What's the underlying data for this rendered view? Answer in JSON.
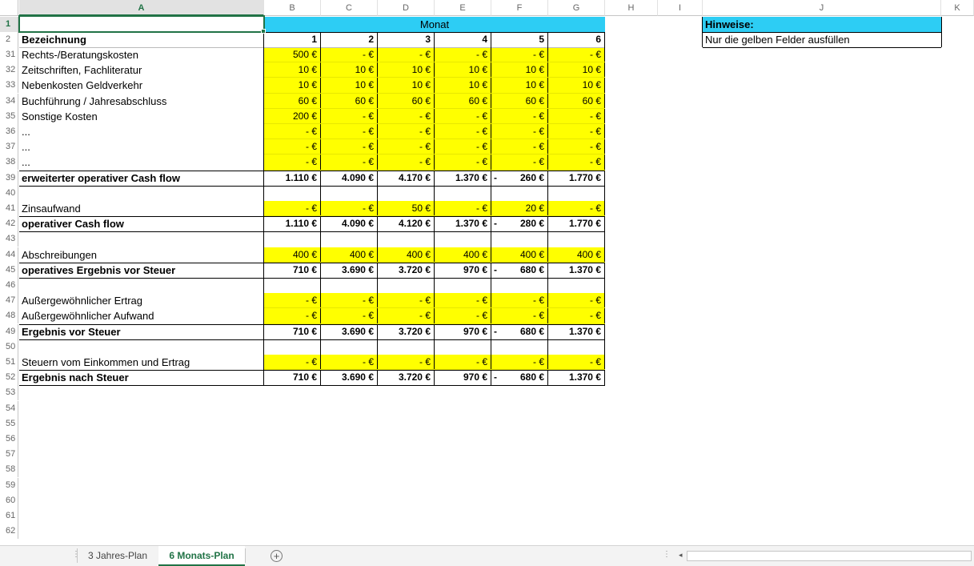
{
  "columns": [
    {
      "letter": "A",
      "selected": true
    },
    {
      "letter": "B"
    },
    {
      "letter": "C"
    },
    {
      "letter": "D"
    },
    {
      "letter": "E"
    },
    {
      "letter": "F"
    },
    {
      "letter": "G"
    },
    {
      "letter": "H"
    },
    {
      "letter": "I"
    },
    {
      "letter": "J"
    },
    {
      "letter": "K"
    }
  ],
  "header": {
    "row1_num": "1",
    "row2_num": "2",
    "monat": "Monat",
    "bezeichnung": "Bezeichnung",
    "months": [
      "1",
      "2",
      "3",
      "4",
      "5",
      "6"
    ]
  },
  "hints": {
    "title": "Hinweise:",
    "text": "Nur die gelben Felder ausfüllen"
  },
  "rows": [
    {
      "num": "31",
      "label": "Rechts-/Beratungskosten",
      "bold": false,
      "yellow": true,
      "values": [
        "500 €",
        "-   €",
        "-   €",
        "-   €",
        "-   €",
        "-   €"
      ]
    },
    {
      "num": "32",
      "label": "Zeitschriften, Fachliteratur",
      "bold": false,
      "yellow": true,
      "values": [
        "10 €",
        "10 €",
        "10 €",
        "10 €",
        "10 €",
        "10 €"
      ]
    },
    {
      "num": "33",
      "label": "Nebenkosten Geldverkehr",
      "bold": false,
      "yellow": true,
      "values": [
        "10 €",
        "10 €",
        "10 €",
        "10 €",
        "10 €",
        "10 €"
      ]
    },
    {
      "num": "34",
      "label": "Buchführung / Jahresabschluss",
      "bold": false,
      "yellow": true,
      "values": [
        "60 €",
        "60 €",
        "60 €",
        "60 €",
        "60 €",
        "60 €"
      ]
    },
    {
      "num": "35",
      "label": "Sonstige Kosten",
      "bold": false,
      "yellow": true,
      "values": [
        "200 €",
        "-   €",
        "-   €",
        "-   €",
        "-   €",
        "-   €"
      ]
    },
    {
      "num": "36",
      "label": "...",
      "bold": false,
      "yellow": true,
      "values": [
        "-   €",
        "-   €",
        "-   €",
        "-   €",
        "-   €",
        "-   €"
      ]
    },
    {
      "num": "37",
      "label": "...",
      "bold": false,
      "yellow": true,
      "values": [
        "-   €",
        "-   €",
        "-   €",
        "-   €",
        "-   €",
        "-   €"
      ]
    },
    {
      "num": "38",
      "label": "...",
      "bold": false,
      "yellow": true,
      "values": [
        "-   €",
        "-   €",
        "-   €",
        "-   €",
        "-   €",
        "-   €"
      ]
    },
    {
      "num": "39",
      "label": "erweiterter operativer Cash flow",
      "bold": true,
      "yellow": false,
      "total": true,
      "values": [
        "1.110 €",
        "4.090 €",
        "4.170 €",
        "1.370 €",
        "260 €",
        "1.770 €"
      ],
      "neg": [
        false,
        false,
        false,
        false,
        true,
        false
      ]
    },
    {
      "num": "40",
      "label": "",
      "bold": false,
      "yellow": false,
      "spacer": true,
      "values": [
        "",
        "",
        "",
        "",
        "",
        ""
      ]
    },
    {
      "num": "41",
      "label": "Zinsaufwand",
      "bold": false,
      "yellow": true,
      "values": [
        "-   €",
        "-   €",
        "50 €",
        "-   €",
        "20 €",
        "-   €"
      ]
    },
    {
      "num": "42",
      "label": "operativer Cash flow",
      "bold": true,
      "yellow": false,
      "total": true,
      "values": [
        "1.110 €",
        "4.090 €",
        "4.120 €",
        "1.370 €",
        "280 €",
        "1.770 €"
      ],
      "neg": [
        false,
        false,
        false,
        false,
        true,
        false
      ]
    },
    {
      "num": "43",
      "label": "",
      "bold": false,
      "yellow": false,
      "spacer": true,
      "values": [
        "",
        "",
        "",
        "",
        "",
        ""
      ]
    },
    {
      "num": "44",
      "label": "Abschreibungen",
      "bold": false,
      "yellow": true,
      "values": [
        "400 €",
        "400 €",
        "400 €",
        "400 €",
        "400 €",
        "400 €"
      ]
    },
    {
      "num": "45",
      "label": "operatives Ergebnis vor Steuer",
      "bold": true,
      "yellow": false,
      "total": true,
      "values": [
        "710 €",
        "3.690 €",
        "3.720 €",
        "970 €",
        "680 €",
        "1.370 €"
      ],
      "neg": [
        false,
        false,
        false,
        false,
        true,
        false
      ]
    },
    {
      "num": "46",
      "label": "",
      "bold": false,
      "yellow": false,
      "spacer": true,
      "values": [
        "",
        "",
        "",
        "",
        "",
        ""
      ]
    },
    {
      "num": "47",
      "label": "Außergewöhnlicher Ertrag",
      "bold": false,
      "yellow": true,
      "values": [
        "-   €",
        "-   €",
        "-   €",
        "-   €",
        "-   €",
        "-   €"
      ]
    },
    {
      "num": "48",
      "label": "Außergewöhnlicher Aufwand",
      "bold": false,
      "yellow": true,
      "values": [
        "-   €",
        "-   €",
        "-   €",
        "-   €",
        "-   €",
        "-   €"
      ]
    },
    {
      "num": "49",
      "label": "Ergebnis vor Steuer",
      "bold": true,
      "yellow": false,
      "total": true,
      "values": [
        "710 €",
        "3.690 €",
        "3.720 €",
        "970 €",
        "680 €",
        "1.370 €"
      ],
      "neg": [
        false,
        false,
        false,
        false,
        true,
        false
      ]
    },
    {
      "num": "50",
      "label": "",
      "bold": false,
      "yellow": false,
      "spacer": true,
      "values": [
        "",
        "",
        "",
        "",
        "",
        ""
      ]
    },
    {
      "num": "51",
      "label": "Steuern vom Einkommen und Ertrag",
      "bold": false,
      "yellow": true,
      "values": [
        "-   €",
        "-   €",
        "-   €",
        "-   €",
        "-   €",
        "-   €"
      ]
    },
    {
      "num": "52",
      "label": "Ergebnis nach Steuer",
      "bold": true,
      "yellow": false,
      "total": true,
      "values": [
        "710 €",
        "3.690 €",
        "3.720 €",
        "970 €",
        "680 €",
        "1.370 €"
      ],
      "neg": [
        false,
        false,
        false,
        false,
        true,
        false
      ]
    }
  ],
  "empty_rows": [
    "53",
    "54",
    "55",
    "56",
    "57",
    "58",
    "59",
    "60",
    "61",
    "62"
  ],
  "tabs": [
    {
      "label": "3 Jahres-Plan",
      "active": false
    },
    {
      "label": "6 Monats-Plan",
      "active": true
    }
  ],
  "add_sheet_label": "+",
  "colors": {
    "accent": "#217346",
    "yellow": "#ffff00",
    "header_blue": "#2dcdf4"
  }
}
